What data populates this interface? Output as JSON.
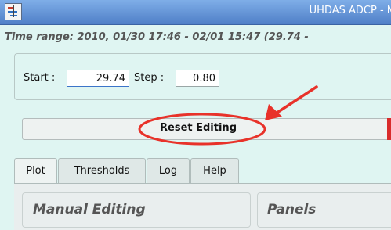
{
  "window": {
    "title": "UHDAS ADCP - M"
  },
  "time_range": {
    "text": "Time range: 2010, 01/30 17:46 - 02/01 15:47 (29.74 -"
  },
  "range": {
    "start_label": "Start :",
    "start_value": "29.74",
    "step_label": "Step :",
    "step_value": "0.80"
  },
  "actions": {
    "reset_label": "Reset Editing"
  },
  "tabs": [
    {
      "label": "Plot"
    },
    {
      "label": "Thresholds"
    },
    {
      "label": "Log"
    },
    {
      "label": "Help"
    }
  ],
  "groups": {
    "manual_editing": "Manual Editing",
    "panels": "Panels"
  },
  "colors": {
    "annotation": "#e8322a",
    "titlebar": "#5b8ad1"
  }
}
